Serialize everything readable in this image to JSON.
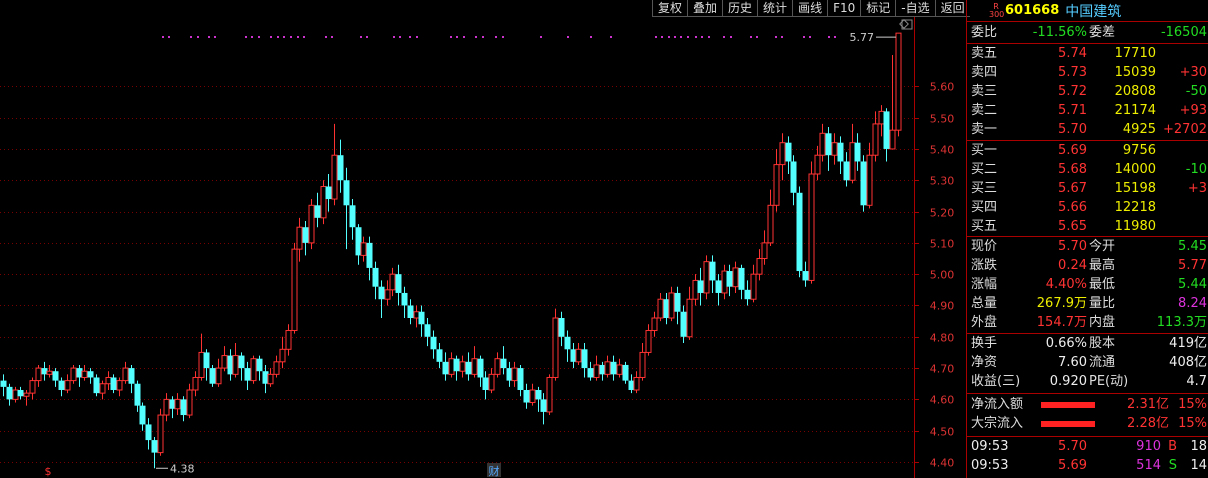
{
  "toolbar": [
    "复权",
    "叠加",
    "历史",
    "统计",
    "画线",
    "F10",
    "标记",
    "-自选",
    "返回"
  ],
  "chart_data": {
    "type": "candlestick",
    "y_ticks": [
      "5.60",
      "5.50",
      "5.40",
      "5.30",
      "5.20",
      "5.10",
      "5.00",
      "4.90",
      "4.80",
      "4.70",
      "4.60",
      "4.50",
      "4.40"
    ],
    "ylim": [
      4.4,
      5.78
    ],
    "high_label": "5.77",
    "low_label": "4.38",
    "bottom_markers": [
      "$",
      "财"
    ],
    "candles": [
      [
        4.66,
        4.64,
        4.68,
        4.61
      ],
      [
        4.64,
        4.6,
        4.65,
        4.58
      ],
      [
        4.6,
        4.63,
        4.64,
        4.59
      ],
      [
        4.63,
        4.61,
        4.64,
        4.6
      ],
      [
        4.61,
        4.62,
        4.63,
        4.58
      ],
      [
        4.62,
        4.66,
        4.67,
        4.6
      ],
      [
        4.66,
        4.7,
        4.71,
        4.64
      ],
      [
        4.7,
        4.68,
        4.72,
        4.66
      ],
      [
        4.68,
        4.69,
        4.71,
        4.67
      ],
      [
        4.69,
        4.66,
        4.7,
        4.64
      ],
      [
        4.66,
        4.63,
        4.67,
        4.61
      ],
      [
        4.63,
        4.66,
        4.68,
        4.62
      ],
      [
        4.66,
        4.7,
        4.71,
        4.65
      ],
      [
        4.7,
        4.67,
        4.71,
        4.64
      ],
      [
        4.67,
        4.69,
        4.71,
        4.66
      ],
      [
        4.69,
        4.67,
        4.7,
        4.65
      ],
      [
        4.67,
        4.62,
        4.68,
        4.61
      ],
      [
        4.62,
        4.65,
        4.66,
        4.6
      ],
      [
        4.65,
        4.67,
        4.69,
        4.63
      ],
      [
        4.67,
        4.63,
        4.68,
        4.62
      ],
      [
        4.63,
        4.66,
        4.67,
        4.61
      ],
      [
        4.66,
        4.7,
        4.72,
        4.65
      ],
      [
        4.7,
        4.65,
        4.71,
        4.62
      ],
      [
        4.65,
        4.58,
        4.66,
        4.56
      ],
      [
        4.58,
        4.52,
        4.59,
        4.5
      ],
      [
        4.52,
        4.47,
        4.54,
        4.44
      ],
      [
        4.47,
        4.43,
        4.48,
        4.38
      ],
      [
        4.43,
        4.55,
        4.57,
        4.42
      ],
      [
        4.55,
        4.6,
        4.62,
        4.53
      ],
      [
        4.6,
        4.57,
        4.61,
        4.54
      ],
      [
        4.57,
        4.6,
        4.62,
        4.55
      ],
      [
        4.6,
        4.55,
        4.61,
        4.53
      ],
      [
        4.55,
        4.63,
        4.65,
        4.54
      ],
      [
        4.63,
        4.67,
        4.69,
        4.61
      ],
      [
        4.67,
        4.75,
        4.81,
        4.66
      ],
      [
        4.75,
        4.7,
        4.76,
        4.66
      ],
      [
        4.7,
        4.65,
        4.71,
        4.64
      ],
      [
        4.65,
        4.7,
        4.73,
        4.64
      ],
      [
        4.7,
        4.74,
        4.77,
        4.69
      ],
      [
        4.74,
        4.68,
        4.76,
        4.66
      ],
      [
        4.68,
        4.74,
        4.78,
        4.67
      ],
      [
        4.74,
        4.7,
        4.75,
        4.66
      ],
      [
        4.7,
        4.66,
        4.72,
        4.63
      ],
      [
        4.66,
        4.73,
        4.74,
        4.65
      ],
      [
        4.73,
        4.69,
        4.74,
        4.66
      ],
      [
        4.69,
        4.65,
        4.71,
        4.62
      ],
      [
        4.65,
        4.68,
        4.7,
        4.64
      ],
      [
        4.68,
        4.72,
        4.74,
        4.67
      ],
      [
        4.72,
        4.76,
        4.8,
        4.7
      ],
      [
        4.76,
        4.82,
        4.84,
        4.74
      ],
      [
        4.82,
        5.08,
        5.1,
        4.81
      ],
      [
        5.08,
        5.15,
        5.18,
        5.04
      ],
      [
        5.15,
        5.1,
        5.17,
        5.06
      ],
      [
        5.1,
        5.22,
        5.24,
        5.08
      ],
      [
        5.22,
        5.18,
        5.26,
        5.15
      ],
      [
        5.18,
        5.28,
        5.3,
        5.16
      ],
      [
        5.28,
        5.24,
        5.32,
        5.2
      ],
      [
        5.24,
        5.38,
        5.48,
        5.22
      ],
      [
        5.38,
        5.3,
        5.43,
        5.26
      ],
      [
        5.3,
        5.22,
        5.34,
        5.08
      ],
      [
        5.22,
        5.15,
        5.24,
        5.11
      ],
      [
        5.15,
        5.06,
        5.16,
        5.03
      ],
      [
        5.06,
        5.1,
        5.12,
        5.04
      ],
      [
        5.1,
        5.02,
        5.12,
        4.98
      ],
      [
        5.02,
        4.96,
        5.04,
        4.92
      ],
      [
        4.96,
        4.92,
        4.98,
        4.86
      ],
      [
        4.92,
        4.95,
        4.98,
        4.9
      ],
      [
        4.95,
        5.0,
        5.02,
        4.93
      ],
      [
        5.0,
        4.94,
        5.03,
        4.9
      ],
      [
        4.94,
        4.9,
        4.96,
        4.86
      ],
      [
        4.9,
        4.86,
        4.92,
        4.84
      ],
      [
        4.86,
        4.88,
        4.9,
        4.83
      ],
      [
        4.88,
        4.84,
        4.9,
        4.8
      ],
      [
        4.84,
        4.8,
        4.86,
        4.77
      ],
      [
        4.8,
        4.76,
        4.82,
        4.73
      ],
      [
        4.76,
        4.72,
        4.78,
        4.7
      ],
      [
        4.72,
        4.68,
        4.75,
        4.66
      ],
      [
        4.68,
        4.73,
        4.75,
        4.67
      ],
      [
        4.73,
        4.69,
        4.74,
        4.66
      ],
      [
        4.69,
        4.72,
        4.74,
        4.67
      ],
      [
        4.72,
        4.68,
        4.75,
        4.66
      ],
      [
        4.68,
        4.73,
        4.77,
        4.67
      ],
      [
        4.73,
        4.67,
        4.74,
        4.64
      ],
      [
        4.67,
        4.63,
        4.69,
        4.6
      ],
      [
        4.63,
        4.68,
        4.7,
        4.62
      ],
      [
        4.68,
        4.73,
        4.75,
        4.67
      ],
      [
        4.73,
        4.7,
        4.77,
        4.68
      ],
      [
        4.7,
        4.66,
        4.72,
        4.64
      ],
      [
        4.66,
        4.7,
        4.72,
        4.64
      ],
      [
        4.7,
        4.63,
        4.71,
        4.61
      ],
      [
        4.63,
        4.59,
        4.65,
        4.57
      ],
      [
        4.59,
        4.63,
        4.65,
        4.58
      ],
      [
        4.63,
        4.6,
        4.64,
        4.56
      ],
      [
        4.6,
        4.56,
        4.62,
        4.52
      ],
      [
        4.56,
        4.67,
        4.68,
        4.55
      ],
      [
        4.67,
        4.86,
        4.89,
        4.66
      ],
      [
        4.86,
        4.8,
        4.88,
        4.77
      ],
      [
        4.8,
        4.76,
        4.82,
        4.72
      ],
      [
        4.76,
        4.72,
        4.78,
        4.7
      ],
      [
        4.72,
        4.76,
        4.78,
        4.71
      ],
      [
        4.76,
        4.7,
        4.78,
        4.67
      ],
      [
        4.7,
        4.67,
        4.72,
        4.66
      ],
      [
        4.67,
        4.71,
        4.74,
        4.66
      ],
      [
        4.71,
        4.68,
        4.72,
        4.66
      ],
      [
        4.68,
        4.72,
        4.74,
        4.67
      ],
      [
        4.72,
        4.68,
        4.74,
        4.66
      ],
      [
        4.68,
        4.71,
        4.73,
        4.67
      ],
      [
        4.71,
        4.66,
        4.72,
        4.65
      ],
      [
        4.66,
        4.63,
        4.68,
        4.62
      ],
      [
        4.63,
        4.67,
        4.69,
        4.62
      ],
      [
        4.67,
        4.75,
        4.78,
        4.66
      ],
      [
        4.75,
        4.82,
        4.84,
        4.74
      ],
      [
        4.82,
        4.86,
        4.88,
        4.8
      ],
      [
        4.86,
        4.92,
        4.94,
        4.85
      ],
      [
        4.92,
        4.86,
        4.94,
        4.84
      ],
      [
        4.86,
        4.94,
        4.96,
        4.85
      ],
      [
        4.94,
        4.88,
        4.96,
        4.84
      ],
      [
        4.88,
        4.8,
        4.9,
        4.78
      ],
      [
        4.8,
        4.92,
        4.96,
        4.79
      ],
      [
        4.92,
        4.98,
        5.0,
        4.9
      ],
      [
        4.98,
        4.94,
        5.02,
        4.9
      ],
      [
        4.94,
        5.04,
        5.06,
        4.92
      ],
      [
        5.04,
        4.98,
        5.06,
        4.94
      ],
      [
        4.98,
        4.94,
        5.0,
        4.9
      ],
      [
        4.94,
        5.01,
        5.03,
        4.92
      ],
      [
        5.01,
        4.96,
        5.03,
        4.93
      ],
      [
        4.96,
        5.02,
        5.04,
        4.94
      ],
      [
        5.02,
        4.95,
        5.03,
        4.92
      ],
      [
        4.95,
        4.92,
        4.98,
        4.9
      ],
      [
        4.92,
        5.0,
        5.03,
        4.91
      ],
      [
        5.0,
        5.05,
        5.08,
        4.98
      ],
      [
        5.05,
        5.1,
        5.14,
        5.03
      ],
      [
        5.1,
        5.22,
        5.27,
        5.09
      ],
      [
        5.22,
        5.35,
        5.4,
        5.2
      ],
      [
        5.35,
        5.42,
        5.45,
        5.3
      ],
      [
        5.42,
        5.36,
        5.44,
        5.32
      ],
      [
        5.36,
        5.26,
        5.38,
        5.22
      ],
      [
        5.26,
        5.01,
        5.28,
        4.99
      ],
      [
        5.01,
        4.98,
        5.04,
        4.96
      ],
      [
        4.98,
        5.32,
        5.36,
        4.97
      ],
      [
        5.32,
        5.38,
        5.41,
        5.3
      ],
      [
        5.38,
        5.45,
        5.48,
        5.36
      ],
      [
        5.45,
        5.38,
        5.47,
        5.33
      ],
      [
        5.38,
        5.42,
        5.45,
        5.35
      ],
      [
        5.42,
        5.36,
        5.44,
        5.32
      ],
      [
        5.36,
        5.3,
        5.39,
        5.28
      ],
      [
        5.3,
        5.42,
        5.48,
        5.29
      ],
      [
        5.42,
        5.36,
        5.45,
        5.33
      ],
      [
        5.36,
        5.22,
        5.38,
        5.2
      ],
      [
        5.22,
        5.38,
        5.42,
        5.21
      ],
      [
        5.38,
        5.48,
        5.52,
        5.36
      ],
      [
        5.48,
        5.52,
        5.54,
        5.44
      ],
      [
        5.52,
        5.4,
        5.53,
        5.36
      ],
      [
        5.4,
        5.46,
        5.7,
        5.44
      ],
      [
        5.46,
        5.77,
        5.77,
        5.44
      ]
    ]
  },
  "quote": {
    "r_badge_top": "R",
    "r_badge_bottom": "300",
    "code": "601668",
    "name": "中国建筑",
    "weibi_label": "委比",
    "weibi": "-11.56%",
    "weicha_label": "委差",
    "weicha": "-16504",
    "asks": [
      {
        "label": "卖五",
        "price": "5.74",
        "vol": "17710",
        "chg": ""
      },
      {
        "label": "卖四",
        "price": "5.73",
        "vol": "15039",
        "chg": "+30"
      },
      {
        "label": "卖三",
        "price": "5.72",
        "vol": "20808",
        "chg": "-50"
      },
      {
        "label": "卖二",
        "price": "5.71",
        "vol": "21174",
        "chg": "+93"
      },
      {
        "label": "卖一",
        "price": "5.70",
        "vol": "4925",
        "chg": "+2702"
      }
    ],
    "bids": [
      {
        "label": "买一",
        "price": "5.69",
        "vol": "9756",
        "chg": ""
      },
      {
        "label": "买二",
        "price": "5.68",
        "vol": "14000",
        "chg": "-10"
      },
      {
        "label": "买三",
        "price": "5.67",
        "vol": "15198",
        "chg": "+3"
      },
      {
        "label": "买四",
        "price": "5.66",
        "vol": "12218",
        "chg": ""
      },
      {
        "label": "买五",
        "price": "5.65",
        "vol": "11980",
        "chg": ""
      }
    ],
    "stats1": [
      {
        "l1": "现价",
        "v1": "5.70",
        "c1": "red",
        "l2": "今开",
        "v2": "5.45",
        "c2": "green"
      },
      {
        "l1": "涨跌",
        "v1": "0.24",
        "c1": "red",
        "l2": "最高",
        "v2": "5.77",
        "c2": "red"
      },
      {
        "l1": "涨幅",
        "v1": "4.40%",
        "c1": "red",
        "l2": "最低",
        "v2": "5.44",
        "c2": "green"
      },
      {
        "l1": "总量",
        "v1": "267.9万",
        "c1": "yellow",
        "l2": "量比",
        "v2": "8.24",
        "c2": "magenta"
      },
      {
        "l1": "外盘",
        "v1": "154.7万",
        "c1": "red",
        "l2": "内盘",
        "v2": "113.3万",
        "c2": "green"
      }
    ],
    "stats2": [
      {
        "l1": "换手",
        "v1": "0.66%",
        "l2": "股本",
        "v2": "419亿"
      },
      {
        "l1": "净资",
        "v1": "7.60",
        "l2": "流通",
        "v2": "408亿"
      },
      {
        "l1": "收益(三)",
        "v1": "0.920",
        "l2": "PE(动)",
        "v2": "4.7"
      }
    ],
    "flows": [
      {
        "label": "净流入额",
        "value": "2.31亿",
        "pct": "15%"
      },
      {
        "label": "大宗流入",
        "value": "2.28亿",
        "pct": "15%"
      }
    ],
    "ticks": [
      {
        "time": "09:53",
        "price": "5.70",
        "vol": "910",
        "side": "B",
        "n": "18"
      },
      {
        "time": "09:53",
        "price": "5.69",
        "vol": "514",
        "side": "S",
        "n": "14"
      }
    ]
  }
}
